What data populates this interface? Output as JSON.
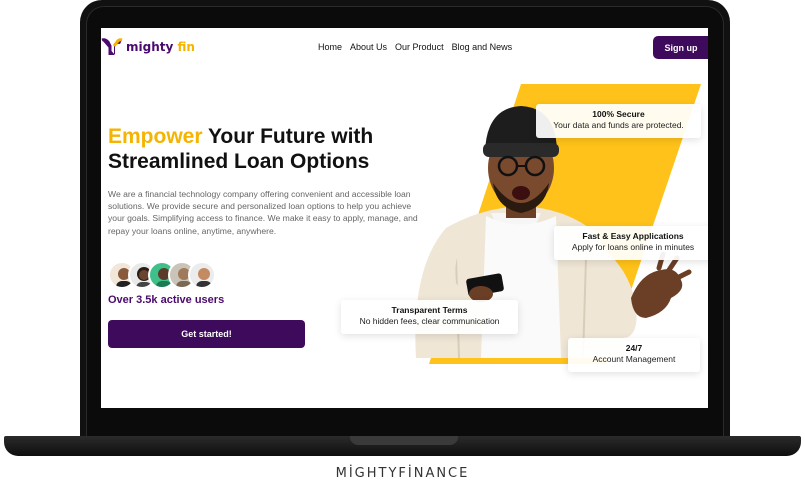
{
  "caption": "MİGHTYFİNANCE",
  "brand": {
    "name_a": "mighty",
    "name_b": "fin"
  },
  "nav": {
    "items": [
      "Home",
      "About Us",
      "Our Product",
      "Blog and News"
    ],
    "signup": "Sign up"
  },
  "hero": {
    "title_highlight": "Empower",
    "title_rest_1": " Your Future with",
    "title_line_2": "Streamlined Loan Options",
    "description": "We are a financial technology company offering convenient and accessible loan solutions. We provide secure and personalized loan options to help you achieve your goals. Simplifying access to finance. We make it easy to apply, manage, and repay your loans online, anytime, anywhere.",
    "active_users": "Over 3.5k active users",
    "cta": "Get started!"
  },
  "features": [
    {
      "title": "100% Secure",
      "subtitle": "Your data and funds are protected."
    },
    {
      "title": "Fast & Easy Applications",
      "subtitle": "Apply for loans online in minutes"
    },
    {
      "title": "Transparent Terms",
      "subtitle": "No hidden fees, clear communication"
    },
    {
      "title": "24/7",
      "subtitle": "Account Management"
    }
  ],
  "colors": {
    "brand_purple": "#3d0a5c",
    "accent_yellow": "#f5b400"
  }
}
